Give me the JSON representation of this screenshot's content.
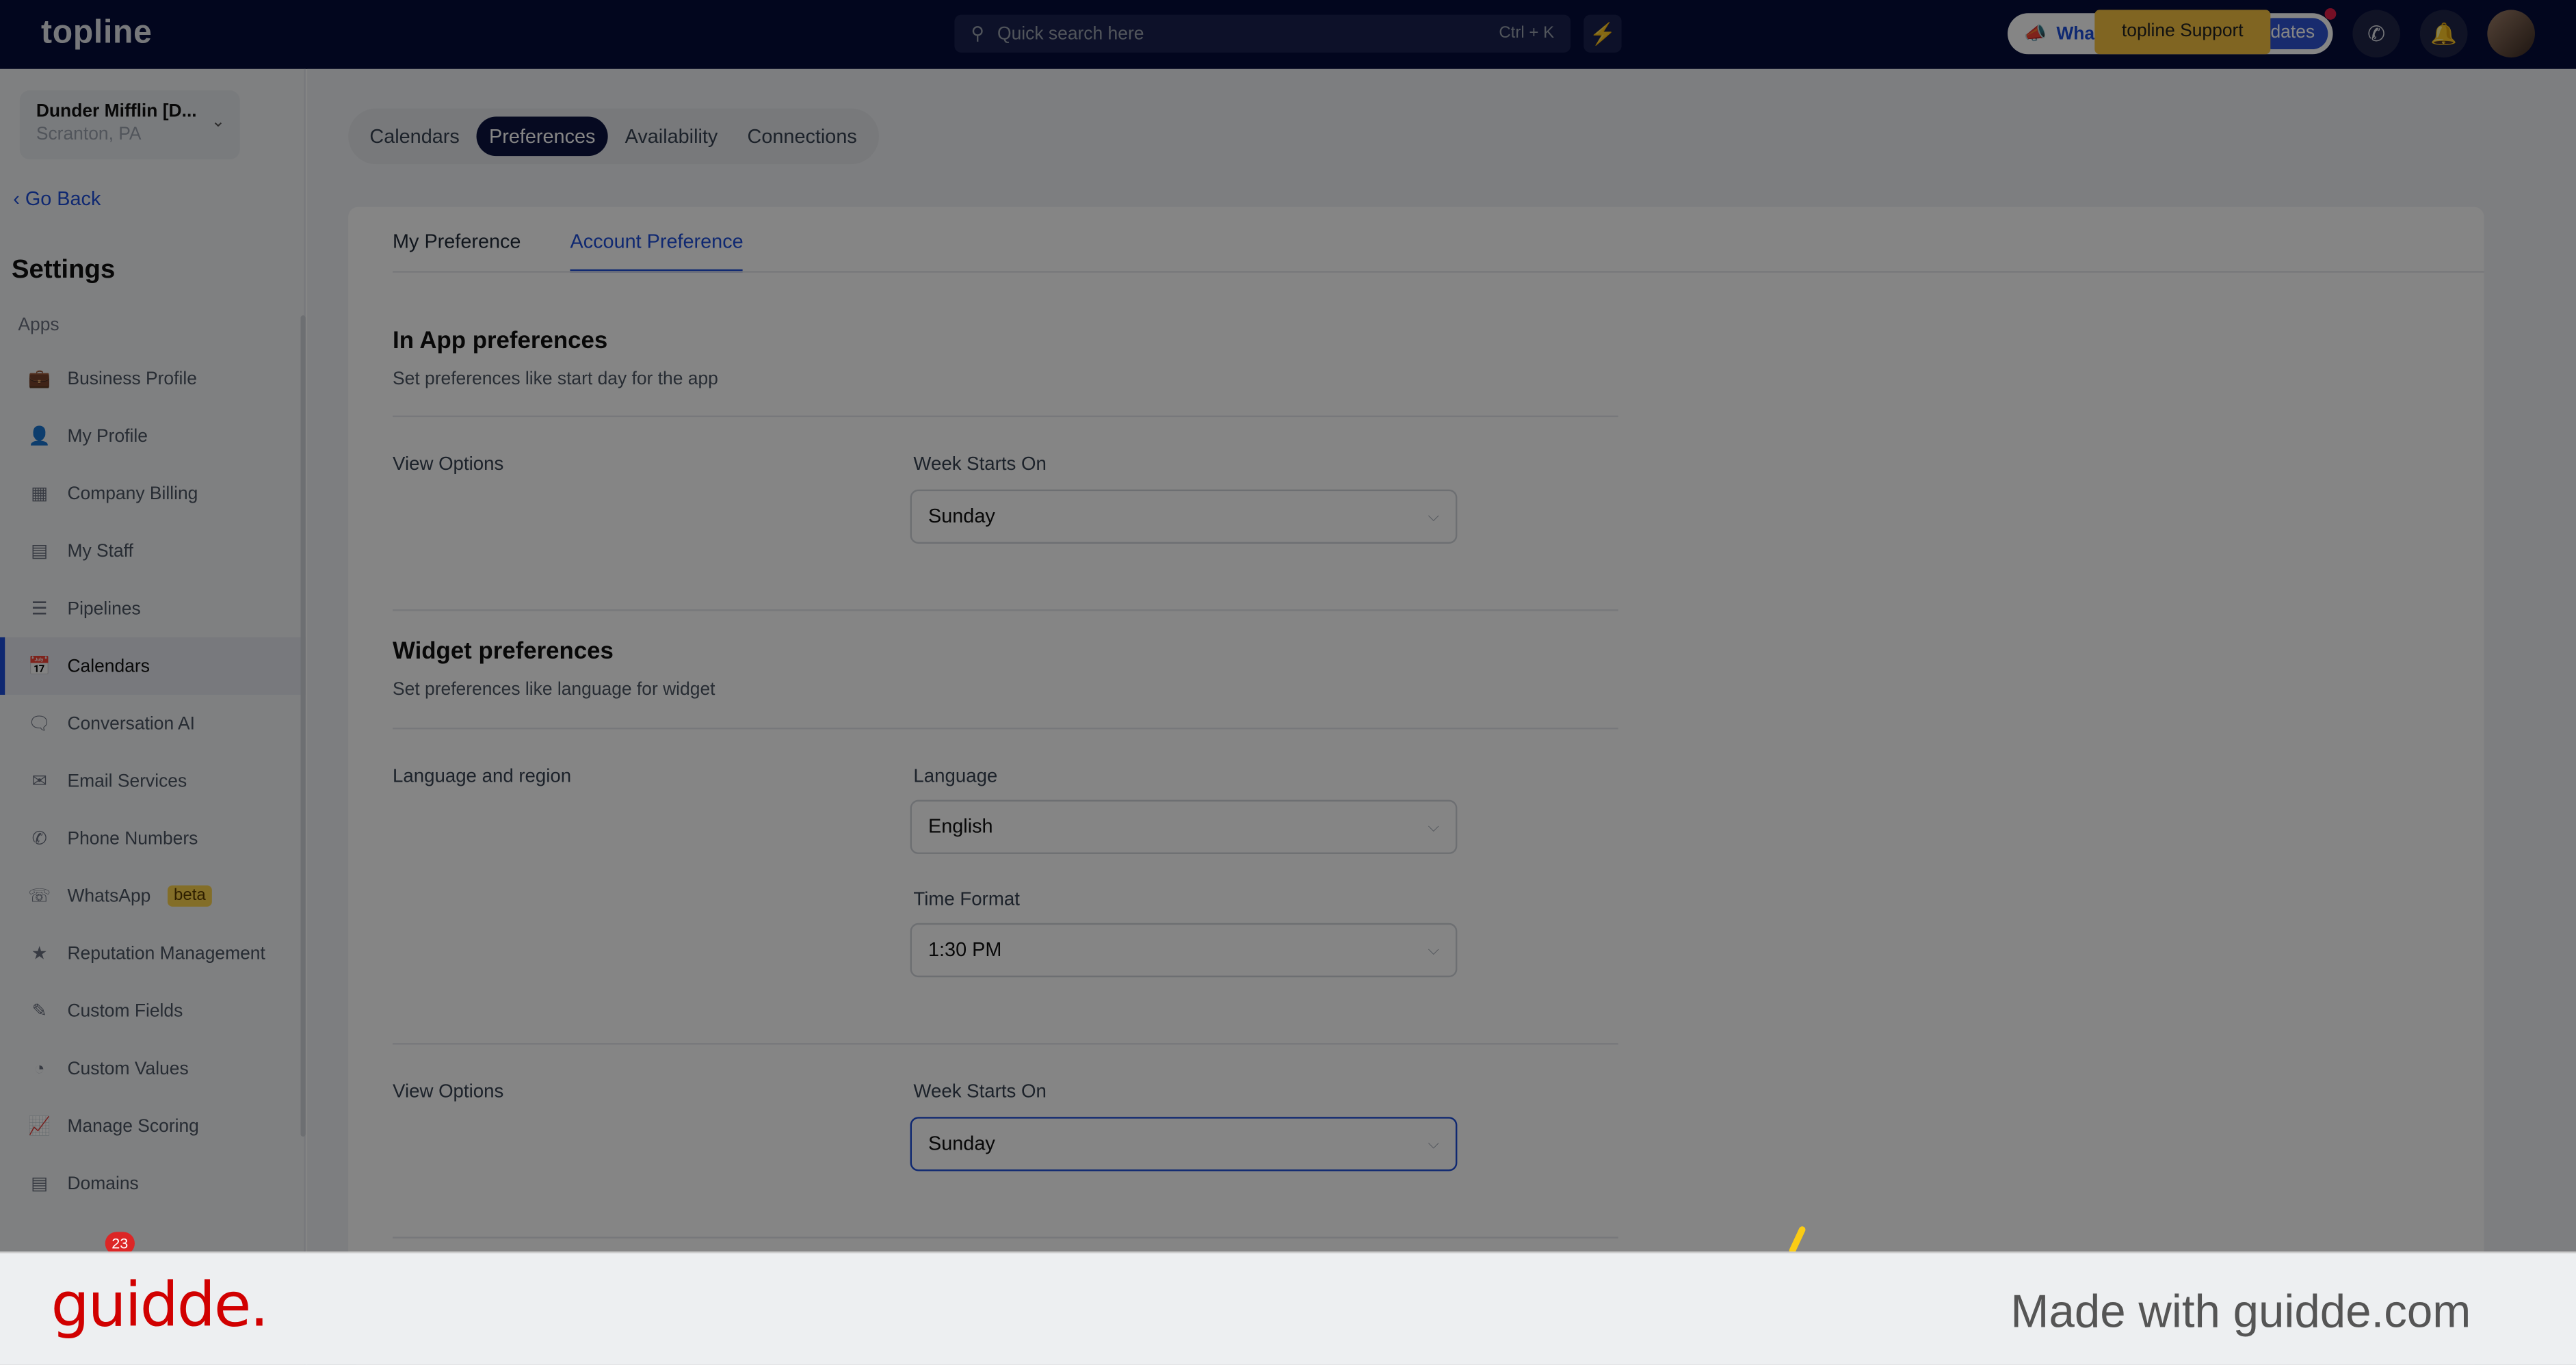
{
  "topbar": {
    "logo": "topline",
    "search_placeholder": "Quick search here",
    "search_shortcut": "Ctrl + K",
    "whats_new": "What's New",
    "updates": "dates",
    "tooltip": "topline Support"
  },
  "account": {
    "name": "Dunder Mifflin [D...",
    "location": "Scranton, PA"
  },
  "sidebar": {
    "go_back": "Go Back",
    "title": "Settings",
    "section": "Apps",
    "items": [
      {
        "label": "Business Profile",
        "icon": "briefcase-icon"
      },
      {
        "label": "My Profile",
        "icon": "user-icon"
      },
      {
        "label": "Company Billing",
        "icon": "grid-icon"
      },
      {
        "label": "My Staff",
        "icon": "staff-icon"
      },
      {
        "label": "Pipelines",
        "icon": "filter-icon"
      },
      {
        "label": "Calendars",
        "icon": "calendar-icon",
        "active": true
      },
      {
        "label": "Conversation AI",
        "icon": "chat-icon"
      },
      {
        "label": "Email Services",
        "icon": "mail-icon"
      },
      {
        "label": "Phone Numbers",
        "icon": "phone-icon"
      },
      {
        "label": "WhatsApp",
        "icon": "whatsapp-icon",
        "badge": "beta"
      },
      {
        "label": "Reputation Management",
        "icon": "star-icon"
      },
      {
        "label": "Custom Fields",
        "icon": "edit-icon"
      },
      {
        "label": "Custom Values",
        "icon": "pie-icon"
      },
      {
        "label": "Manage Scoring",
        "icon": "chart-icon"
      },
      {
        "label": "Domains",
        "icon": "server-icon"
      }
    ],
    "notification_count": "23"
  },
  "tabs": [
    "Calendars",
    "Preferences",
    "Availability",
    "Connections"
  ],
  "subtabs": [
    "My Preference",
    "Account Preference"
  ],
  "in_app": {
    "title": "In App preferences",
    "desc": "Set preferences like start day for the app",
    "row_label": "View Options",
    "field_label": "Week Starts On",
    "value": "Sunday"
  },
  "widget": {
    "title": "Widget preferences",
    "desc": "Set preferences like language for widget",
    "row_label": "Language and region",
    "language_label": "Language",
    "language": "English",
    "time_label": "Time Format",
    "time": "1:30 PM",
    "view_label": "View Options",
    "week_label": "Week Starts On",
    "week": "Sunday"
  },
  "footer": {
    "logo": "guidde.",
    "made_with": "Made with guidde.com"
  }
}
